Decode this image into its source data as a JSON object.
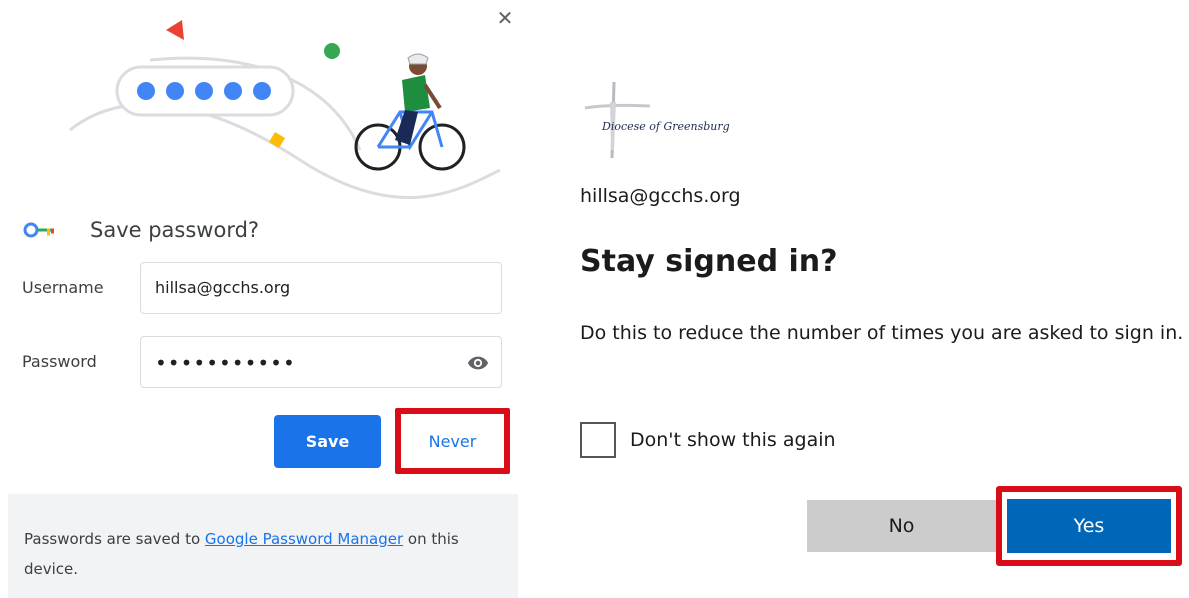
{
  "save_password_bubble": {
    "close_label": "✕",
    "title": "Save password?",
    "username_label": "Username",
    "username_value": "hillsa@gcchs.org",
    "password_label": "Password",
    "password_dots": "•••••••••••",
    "save_label": "Save",
    "never_label": "Never",
    "footer_prefix": "Passwords are saved to ",
    "footer_link": "Google Password Manager",
    "footer_suffix": " on this device.",
    "illustration_icon": "password-bubble-cyclist",
    "key_icon": "key-icon",
    "eye_icon": "eye-icon",
    "accent_color": "#1a73e8"
  },
  "stay_signed_in": {
    "logo_text": "Diocese of Greensburg",
    "account_email": "hillsa@gcchs.org",
    "title": "Stay signed in?",
    "description": "Do this to reduce the number of times you are asked to sign in.",
    "checkbox_label": "Don't show this again",
    "no_label": "No",
    "yes_label": "Yes",
    "yes_color": "#0067b8",
    "highlight_color": "#d80d17"
  }
}
